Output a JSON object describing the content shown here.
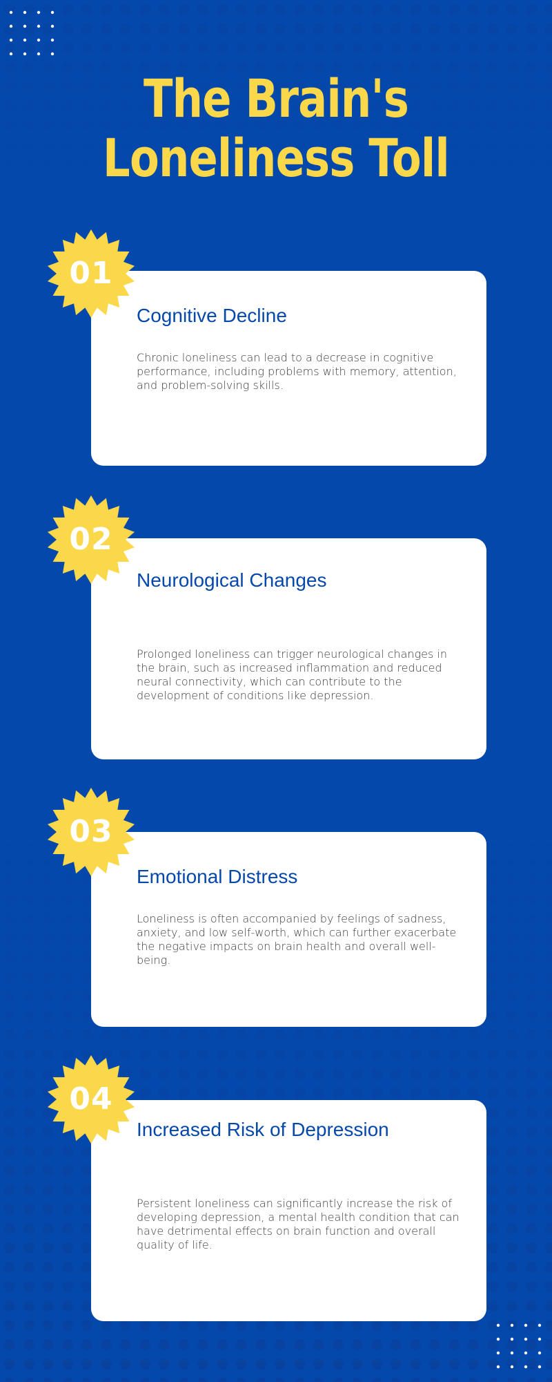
{
  "title_lines": [
    "The Brain's",
    "Loneliness Toll"
  ],
  "colors": {
    "background": "#0548AB",
    "accent_yellow": "#FBD84A",
    "card": "#FFFFFF",
    "heading_blue": "#0548AB",
    "body_text": "#3B3B3B"
  },
  "sections": [
    {
      "number": "01",
      "heading": "Cognitive Decline",
      "body": "Chronic loneliness can lead to a decrease in cognitive performance, including problems with memory, attention, and problem-solving skills."
    },
    {
      "number": "02",
      "heading": "Neurological Changes",
      "body": "Prolonged loneliness can trigger neurological changes in the brain, such as increased inflammation and reduced neural connectivity, which can contribute to the development of conditions like depression."
    },
    {
      "number": "03",
      "heading": "Emotional Distress",
      "body": "Loneliness is often accompanied by feelings of sadness, anxiety, and low self-worth, which can further exacerbate the negative impacts on brain health and overall well-being."
    },
    {
      "number": "04",
      "heading": "Increased Risk of Depression",
      "body": "Persistent loneliness can significantly increase the risk of developing depression, a mental health condition that can have detrimental effects on brain function and overall quality of life."
    }
  ]
}
